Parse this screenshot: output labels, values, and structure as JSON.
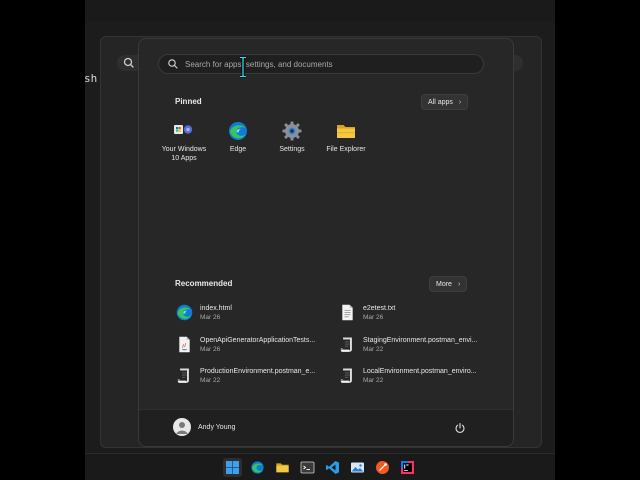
{
  "background": {
    "partial_text": "sh",
    "search_icon": "search-icon"
  },
  "search": {
    "placeholder": "Search for apps, settings, and documents",
    "icon": "search-icon"
  },
  "pinned": {
    "title": "Pinned",
    "all_apps_label": "All apps",
    "items": [
      {
        "label": "Your Windows 10 Apps",
        "icon": "windows-apps-icon"
      },
      {
        "label": "Edge",
        "icon": "edge-icon"
      },
      {
        "label": "Settings",
        "icon": "settings-gear-icon"
      },
      {
        "label": "File Explorer",
        "icon": "folder-icon"
      }
    ]
  },
  "recommended": {
    "title": "Recommended",
    "more_label": "More",
    "items": [
      {
        "name": "index.html",
        "date": "Mar 26",
        "icon": "edge-icon"
      },
      {
        "name": "e2etest.txt",
        "date": "Mar 26",
        "icon": "text-file-icon"
      },
      {
        "name": "OpenApiGeneratorApplicationTests...",
        "date": "Mar 26",
        "icon": "java-file-icon"
      },
      {
        "name": "StagingEnvironment.postman_envi...",
        "date": "Mar 22",
        "icon": "script-file-icon"
      },
      {
        "name": "ProductionEnvironment.postman_e...",
        "date": "Mar 22",
        "icon": "script-file-icon"
      },
      {
        "name": "LocalEnvironment.postman_enviro...",
        "date": "Mar 22",
        "icon": "script-file-icon"
      }
    ]
  },
  "user": {
    "name": "Andy Young",
    "avatar_icon": "user-avatar-icon",
    "power_icon": "power-icon"
  },
  "taskbar": {
    "icons": [
      "windows-start-icon",
      "edge-icon",
      "file-explorer-icon",
      "terminal-icon",
      "vscode-icon",
      "photos-icon",
      "postman-icon",
      "intellij-icon"
    ]
  },
  "colors": {
    "panel": "#272727",
    "accent_blue": "#0078d4",
    "folder_yellow": "#f2c13d"
  }
}
